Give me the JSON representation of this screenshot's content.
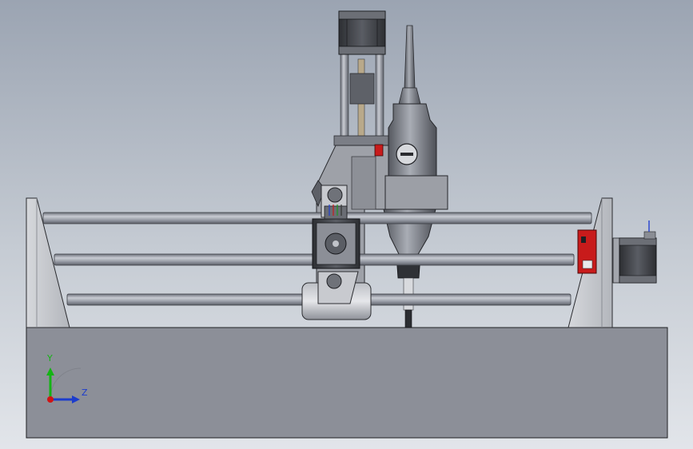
{
  "viewport": {
    "title": ""
  },
  "triad": {
    "y_label": "Y",
    "z_label": "Z",
    "y_color": "#14b414",
    "z_color": "#1c3ccc",
    "x_color": "#d01414"
  },
  "colors": {
    "background_top": "#9ba4b2",
    "background_bottom": "#e2e5ea",
    "base_plate": "#8c8f98",
    "frame_plate": "#c4c6ca",
    "rod": "#8d919c",
    "motor_body": "#4a4c52",
    "electronics_board": "#c81b1b"
  }
}
